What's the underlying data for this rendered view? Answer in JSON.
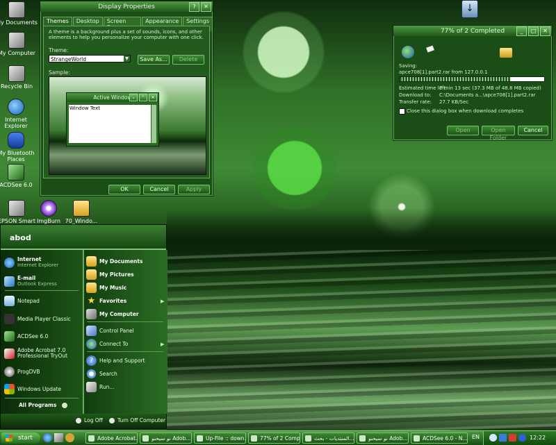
{
  "desktop_icons": [
    {
      "label": "My Documents"
    },
    {
      "label": "My Computer"
    },
    {
      "label": "Recycle Bin"
    },
    {
      "label": "Internet Explorer"
    },
    {
      "label": "My Bluetooth Places"
    },
    {
      "label": "ACDSee 6.0"
    },
    {
      "label": "EPSON Smart Panel"
    },
    {
      "label": "ImgBurn"
    },
    {
      "label": "70_Windo..."
    }
  ],
  "display_props": {
    "title": "Display Properties",
    "tabs": [
      "Themes",
      "Desktop",
      "Screen Saver",
      "Appearance",
      "Settings"
    ],
    "desc": "A theme is a background plus a set of sounds, icons, and other elements to help you personalize your computer with one click.",
    "theme_label": "Theme:",
    "theme_value": "StrangeWorld",
    "save_as": "Save As...",
    "delete": "Delete",
    "sample_label": "Sample:",
    "active_window": "Active Window",
    "window_text": "Window Text",
    "ok": "OK",
    "cancel": "Cancel",
    "apply": "Apply"
  },
  "download": {
    "title": "77% of 2 Completed",
    "saving": "Saving:",
    "file": "apce708[1].part2.rar from 127.0.0.1",
    "progress": 0.77,
    "est_label": "Estimated time left:",
    "est_value": "7 min 13 sec (37.3 MB of 48.8 MB copied)",
    "dl_label": "Download to:",
    "dl_value": "C:\\Documents a...\\apce708[1].part2.rar",
    "rate_label": "Transfer rate:",
    "rate_value": "27.7 KB/Sec",
    "close_check": "Close this dialog box when download completes",
    "open": "Open",
    "open_folder": "Open Folder",
    "cancel": "Cancel"
  },
  "start_menu": {
    "user": "abod",
    "left": [
      {
        "title": "Internet",
        "sub": "Internet Explorer"
      },
      {
        "title": "E-mail",
        "sub": "Outlook Express"
      },
      {
        "title": "Notepad",
        "sub": ""
      },
      {
        "title": "Media Player Classic",
        "sub": ""
      },
      {
        "title": "ACDSee 6.0",
        "sub": ""
      },
      {
        "title": "Adobe Acrobat 7.0 Professional TryOut",
        "sub": ""
      },
      {
        "title": "ProgDVB",
        "sub": ""
      },
      {
        "title": "Windows Update",
        "sub": ""
      }
    ],
    "all_programs": "All Programs",
    "right": [
      {
        "label": "My Documents"
      },
      {
        "label": "My Pictures"
      },
      {
        "label": "My Music"
      },
      {
        "label": "Favorites"
      },
      {
        "label": "My Computer"
      },
      {
        "label": "Control Panel"
      },
      {
        "label": "Connect To"
      },
      {
        "label": "Help and Support"
      },
      {
        "label": "Search"
      },
      {
        "label": "Run..."
      }
    ],
    "log_off": "Log Off",
    "turn_off": "Turn Off Computer"
  },
  "taskbar": {
    "start": "start",
    "items": [
      {
        "label": "Adobe Acrobat..."
      },
      {
        "label": "نو سيحنو Adob..."
      },
      {
        "label": "Up-File :: down..."
      },
      {
        "label": "77% of 2 Comp..."
      },
      {
        "label": "المنتديات - بحث..."
      },
      {
        "label": "نو سيحنو Adob..."
      },
      {
        "label": "ACDSee 6.0 - N..."
      }
    ],
    "lang": "EN",
    "clock": "12:22"
  }
}
